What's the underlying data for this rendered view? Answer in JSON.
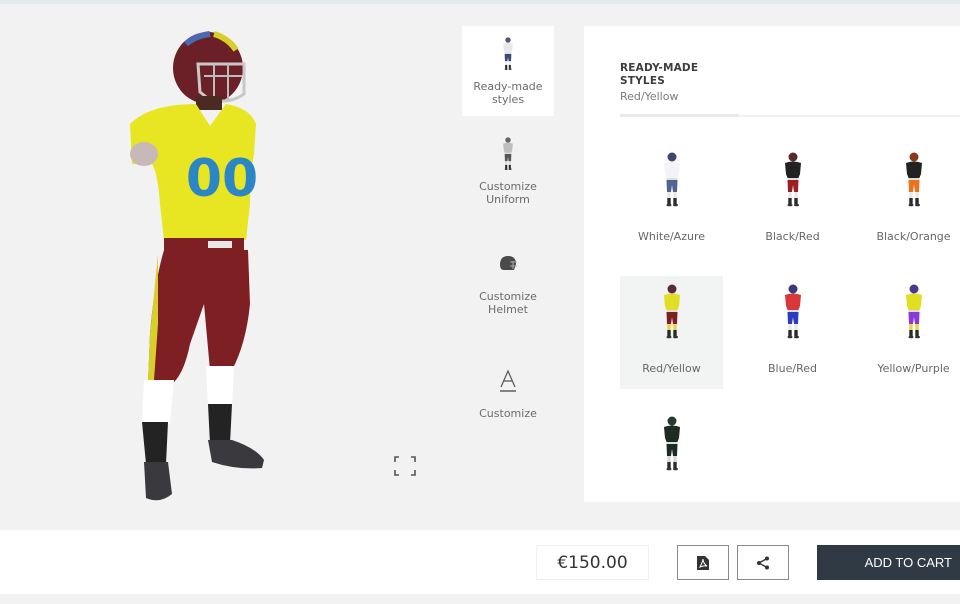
{
  "menu": {
    "items": [
      {
        "label": "Ready-made styles",
        "icon": "player-icon",
        "active": true
      },
      {
        "label": "Customize Uniform",
        "icon": "uniform-icon",
        "active": false
      },
      {
        "label": "Customize Helmet",
        "icon": "helmet-icon",
        "active": false
      },
      {
        "label": "Customize",
        "icon": "text-icon",
        "active": false
      }
    ]
  },
  "panel": {
    "title": "READY-MADE STYLES",
    "subtitle": "Red/Yellow"
  },
  "styles": [
    {
      "name": "White/Azure",
      "jersey": "#f4f4f6",
      "pants": "#4e6690",
      "helmet": "#3f4770",
      "socks": "#e8e8e8",
      "selected": false
    },
    {
      "name": "Black/Red",
      "jersey": "#222222",
      "pants": "#9c1f24",
      "helmet": "#5a2a2a",
      "socks": "#e8e8e8",
      "selected": false
    },
    {
      "name": "Black/Orange",
      "jersey": "#222222",
      "pants": "#e9731f",
      "helmet": "#8a3a1a",
      "socks": "#e8e8e8",
      "selected": false
    },
    {
      "name": "Red/Yellow",
      "jersey": "#e2de21",
      "pants": "#7d1e22",
      "helmet": "#5a2a3a",
      "socks": "#e8d24a",
      "selected": true
    },
    {
      "name": "Blue/Red",
      "jersey": "#d8383a",
      "pants": "#2a3cc0",
      "helmet": "#3a3a7a",
      "socks": "#e8e8e8",
      "selected": false
    },
    {
      "name": "Yellow/Purple",
      "jersey": "#e2de21",
      "pants": "#8a38d8",
      "helmet": "#4a3a8a",
      "socks": "#e8d24a",
      "selected": false
    },
    {
      "name": "",
      "jersey": "#1f2a22",
      "pants": "#1f2a22",
      "helmet": "#2a3a2a",
      "socks": "#d8d8d8",
      "selected": false
    }
  ],
  "model": {
    "jersey_color": "#e8e523",
    "number": "00",
    "number_color": "#2b86c5",
    "pants_color": "#7e1f24",
    "stripe_color": "#d8cf2a",
    "helmet_color": "#6b2028",
    "socks_color": "#ffffff",
    "sock_lower_color": "#232323",
    "cleat_color": "#3a3a3e"
  },
  "footer": {
    "price": "€150.00",
    "pdf_icon": "pdf-icon",
    "share_icon": "share-icon",
    "cart_label": "ADD TO CART"
  },
  "colors": {
    "cart_bg": "#2f3a44",
    "panel_bg": "#ffffff",
    "page_bg": "#f2f2f2"
  }
}
